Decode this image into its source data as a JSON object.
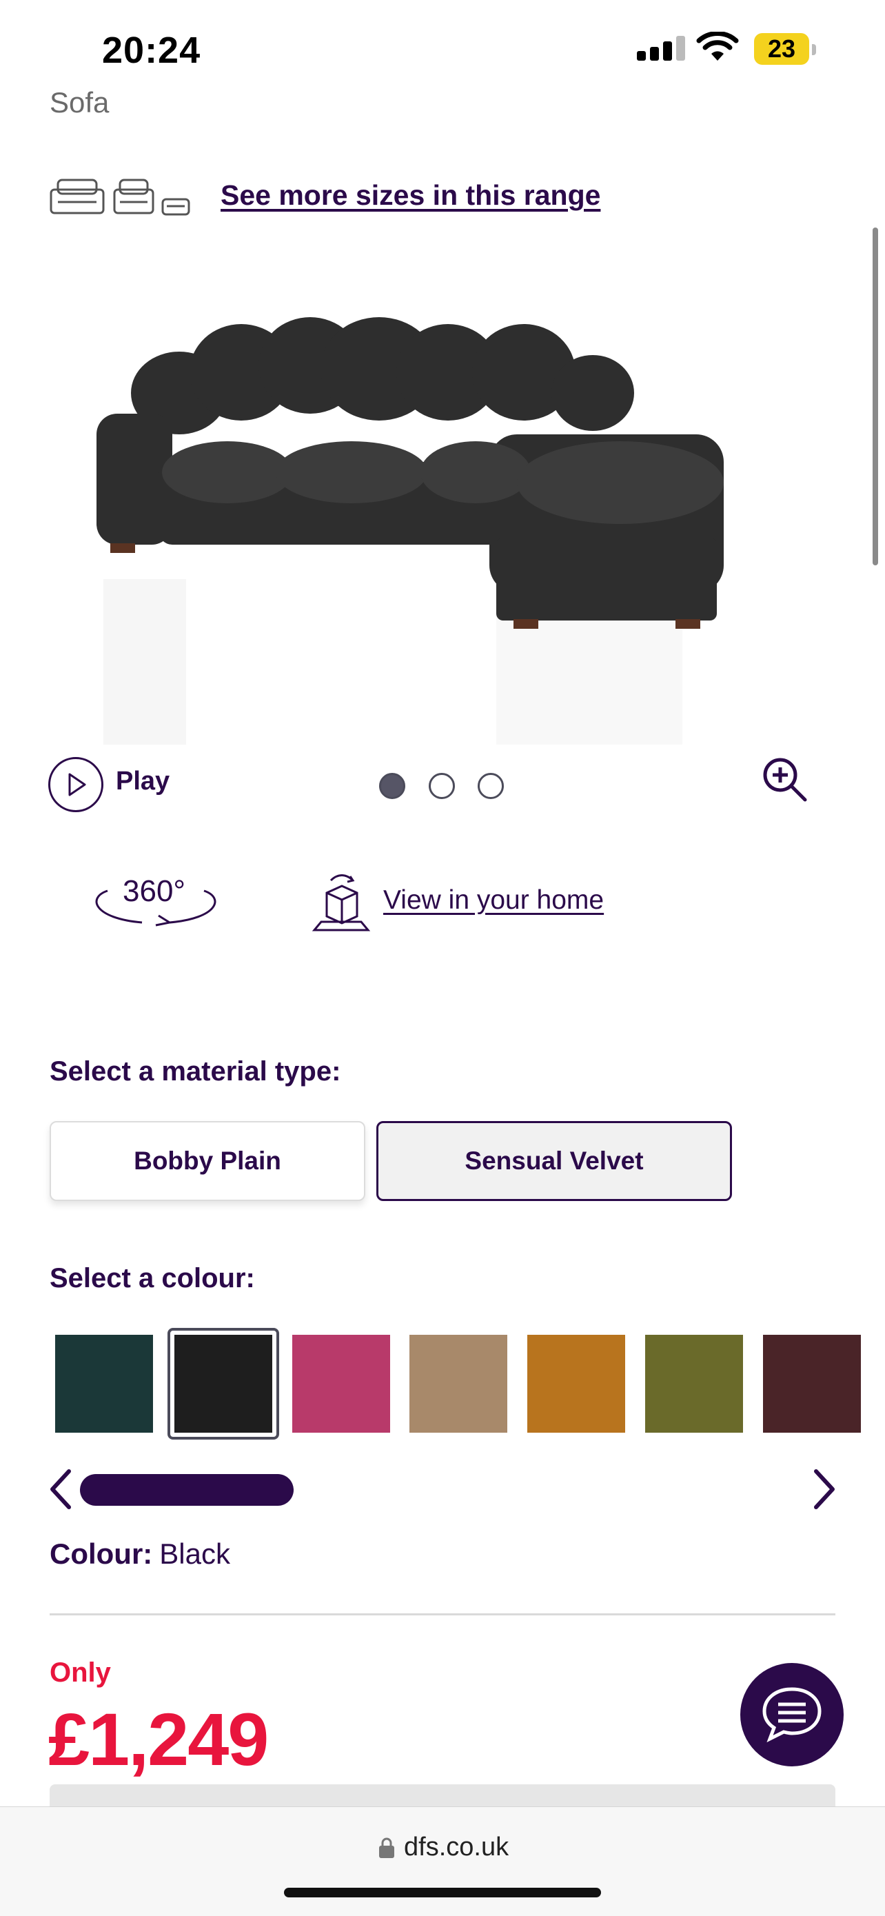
{
  "status_bar": {
    "time": "20:24",
    "battery": "23"
  },
  "product": {
    "type_label": "Sofa"
  },
  "range": {
    "link_text": "See more sizes in this range"
  },
  "gallery": {
    "play_label": "Play",
    "dots": 3,
    "active_dot": 1
  },
  "view_options": {
    "rotate_label": "360°",
    "ar_link": "View in your home"
  },
  "material": {
    "heading": "Select a material type:",
    "options": [
      "Bobby Plain",
      "Sensual Velvet"
    ],
    "selected": "Sensual Velvet"
  },
  "colour": {
    "heading": "Select a colour:",
    "swatches": [
      "#1b3838",
      "#1e1e1e",
      "#b83a6a",
      "#a8896a",
      "#b8741e",
      "#6a6a2a",
      "#4a2428"
    ],
    "selected_index": 1,
    "label": "Colour:",
    "value": "Black"
  },
  "price": {
    "prefix": "Only",
    "amount": "£1,249"
  },
  "browser": {
    "url": "dfs.co.uk"
  },
  "colors": {
    "brand": "#2b0a4a",
    "price": "#e8153d"
  }
}
